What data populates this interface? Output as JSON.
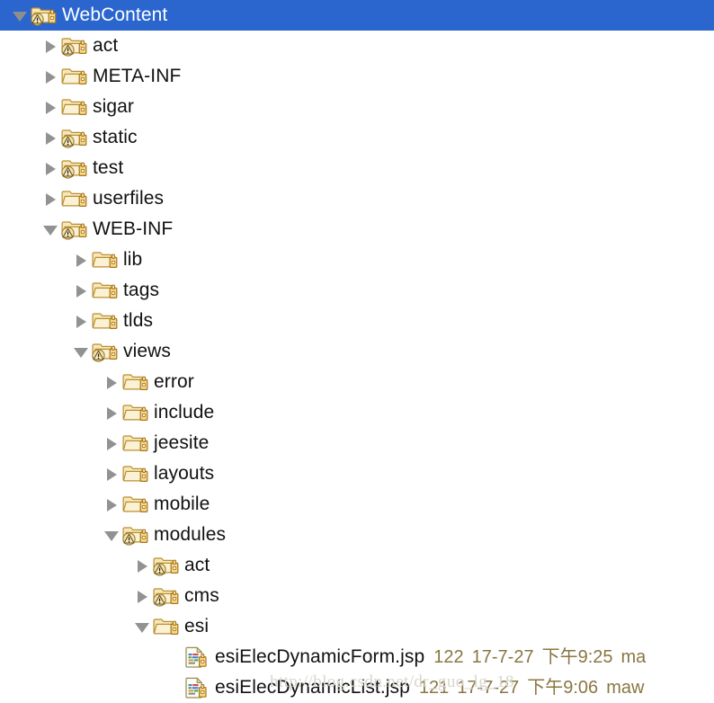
{
  "window": {
    "title": "WebContent",
    "kind": "file-tree-explorer"
  },
  "colors": {
    "selection_background": "#2a66ce",
    "selection_text": "#ffffff",
    "label_text": "#111111",
    "meta_text": "#8a7642",
    "twisty": "#929292",
    "folder_body": "#f5dfa8",
    "folder_edge": "#c79a3c",
    "watermark": "#d9d6ce",
    "background": "#ffffff"
  },
  "watermark": {
    "text": "http://blog.csdn.net/dr_guo_lg_18"
  },
  "tree": {
    "rows": [
      {
        "label": "WebContent",
        "depth": 0,
        "type": "folder",
        "icon": "folder-warning-icon",
        "badge": "warning",
        "state": "expanded",
        "selected": true,
        "twisty": "expanded"
      },
      {
        "label": "act",
        "depth": 1,
        "type": "folder",
        "icon": "folder-warning-icon",
        "badge": "warning",
        "state": "collapsed",
        "selected": false,
        "twisty": "collapsed"
      },
      {
        "label": "META-INF",
        "depth": 1,
        "type": "folder",
        "icon": "folder-icon",
        "badge": "none",
        "state": "collapsed",
        "selected": false,
        "twisty": "collapsed"
      },
      {
        "label": "sigar",
        "depth": 1,
        "type": "folder",
        "icon": "folder-icon",
        "badge": "none",
        "state": "collapsed",
        "selected": false,
        "twisty": "collapsed"
      },
      {
        "label": "static",
        "depth": 1,
        "type": "folder",
        "icon": "folder-warning-icon",
        "badge": "warning",
        "state": "collapsed",
        "selected": false,
        "twisty": "collapsed"
      },
      {
        "label": "test",
        "depth": 1,
        "type": "folder",
        "icon": "folder-warning-icon",
        "badge": "warning",
        "state": "collapsed",
        "selected": false,
        "twisty": "collapsed"
      },
      {
        "label": "userfiles",
        "depth": 1,
        "type": "folder",
        "icon": "folder-icon",
        "badge": "none",
        "state": "collapsed",
        "selected": false,
        "twisty": "collapsed"
      },
      {
        "label": "WEB-INF",
        "depth": 1,
        "type": "folder",
        "icon": "folder-warning-icon",
        "badge": "warning",
        "state": "expanded",
        "selected": false,
        "twisty": "expanded"
      },
      {
        "label": "lib",
        "depth": 2,
        "type": "folder",
        "icon": "folder-icon",
        "badge": "none",
        "state": "collapsed",
        "selected": false,
        "twisty": "collapsed"
      },
      {
        "label": "tags",
        "depth": 2,
        "type": "folder",
        "icon": "folder-icon",
        "badge": "none",
        "state": "collapsed",
        "selected": false,
        "twisty": "collapsed"
      },
      {
        "label": "tlds",
        "depth": 2,
        "type": "folder",
        "icon": "folder-icon",
        "badge": "none",
        "state": "collapsed",
        "selected": false,
        "twisty": "collapsed"
      },
      {
        "label": "views",
        "depth": 2,
        "type": "folder",
        "icon": "folder-warning-icon",
        "badge": "warning",
        "state": "expanded",
        "selected": false,
        "twisty": "expanded"
      },
      {
        "label": "error",
        "depth": 3,
        "type": "folder",
        "icon": "folder-icon",
        "badge": "none",
        "state": "collapsed",
        "selected": false,
        "twisty": "collapsed"
      },
      {
        "label": "include",
        "depth": 3,
        "type": "folder",
        "icon": "folder-icon",
        "badge": "none",
        "state": "collapsed",
        "selected": false,
        "twisty": "collapsed"
      },
      {
        "label": "jeesite",
        "depth": 3,
        "type": "folder",
        "icon": "folder-icon",
        "badge": "none",
        "state": "collapsed",
        "selected": false,
        "twisty": "collapsed"
      },
      {
        "label": "layouts",
        "depth": 3,
        "type": "folder",
        "icon": "folder-icon",
        "badge": "none",
        "state": "collapsed",
        "selected": false,
        "twisty": "collapsed"
      },
      {
        "label": "mobile",
        "depth": 3,
        "type": "folder",
        "icon": "folder-icon",
        "badge": "none",
        "state": "collapsed",
        "selected": false,
        "twisty": "collapsed"
      },
      {
        "label": "modules",
        "depth": 3,
        "type": "folder",
        "icon": "folder-warning-icon",
        "badge": "warning",
        "state": "expanded",
        "selected": false,
        "twisty": "expanded"
      },
      {
        "label": "act",
        "depth": 4,
        "type": "folder",
        "icon": "folder-warning-icon",
        "badge": "warning",
        "state": "collapsed",
        "selected": false,
        "twisty": "collapsed"
      },
      {
        "label": "cms",
        "depth": 4,
        "type": "folder",
        "icon": "folder-warning-icon",
        "badge": "warning",
        "state": "collapsed",
        "selected": false,
        "twisty": "collapsed"
      },
      {
        "label": "esi",
        "depth": 4,
        "type": "folder",
        "icon": "folder-icon",
        "badge": "none",
        "state": "expanded",
        "selected": false,
        "twisty": "expanded"
      },
      {
        "label": "esiElecDynamicForm.jsp",
        "depth": 5,
        "type": "file",
        "icon": "jsp-file-icon",
        "badge": "none",
        "state": "leaf",
        "selected": false,
        "twisty": "none",
        "meta": {
          "revision": "122",
          "date": "17-7-27",
          "time": "下午9:25",
          "author": "ma"
        }
      },
      {
        "label": "esiElecDynamicList.jsp",
        "depth": 5,
        "type": "file",
        "icon": "jsp-file-icon",
        "badge": "none",
        "state": "leaf",
        "selected": false,
        "twisty": "none",
        "meta": {
          "revision": "121",
          "date": "17-7-27",
          "time": "下午9:06",
          "author": "maw"
        }
      }
    ]
  }
}
